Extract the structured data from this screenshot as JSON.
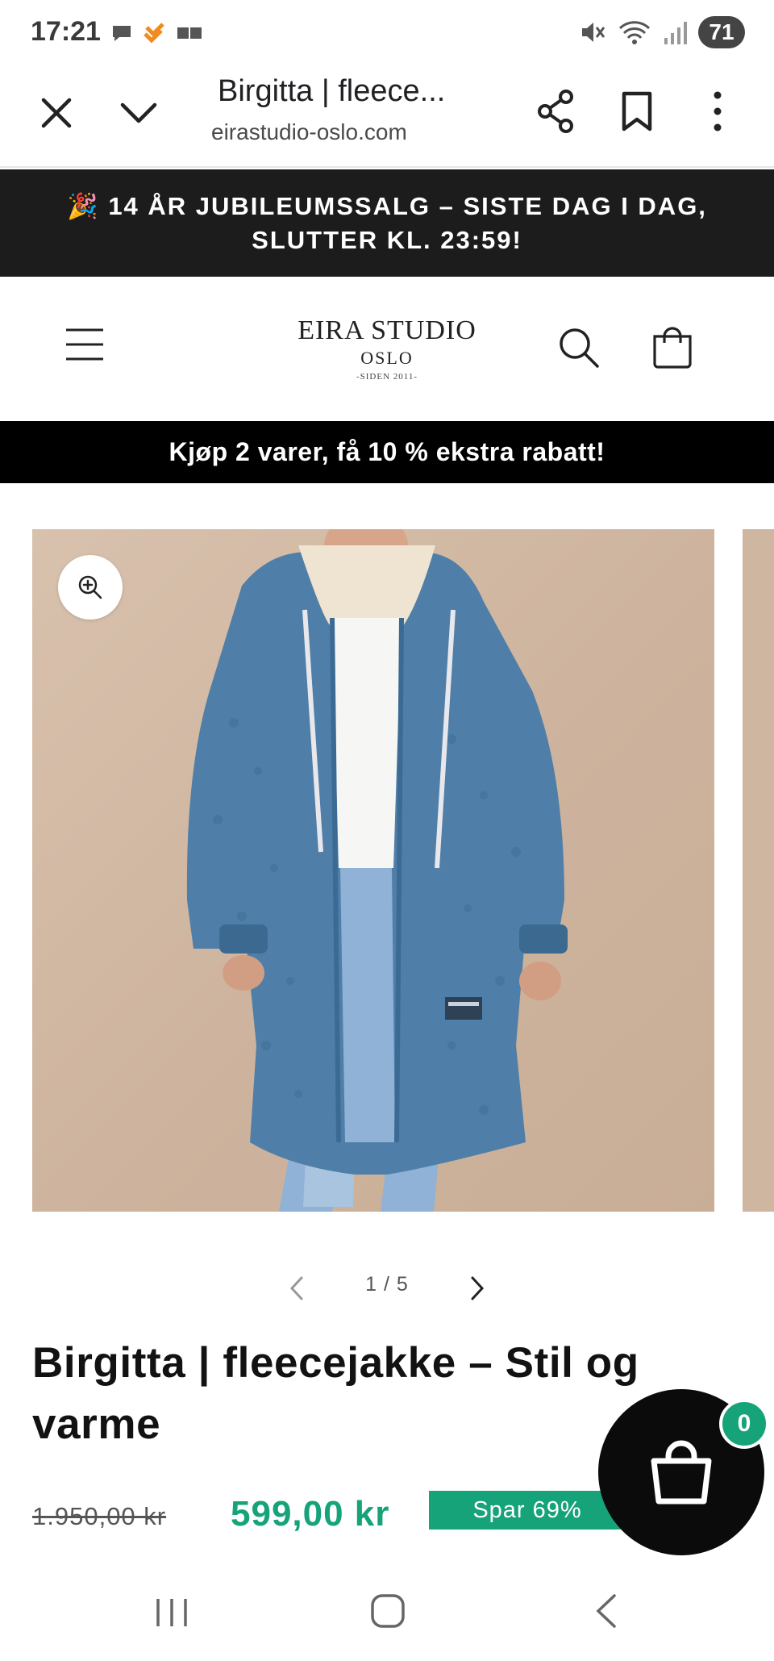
{
  "status_bar": {
    "time": "17:21",
    "battery": "71",
    "icons_left": [
      "chat-bubble-icon",
      "heart-app-icon",
      "media-icon"
    ],
    "icons_right": [
      "mute-icon",
      "wifi-icon",
      "signal-icon"
    ]
  },
  "browser": {
    "page_title": "Birgitta | fleece...",
    "url": "eirastudio-oslo.com"
  },
  "announcement": {
    "emoji": "🎉",
    "text": "14 ÅR JUBILEUMSSALG – SISTE DAG I DAG, SLUTTER KL. 23:59!"
  },
  "header": {
    "logo_line1": "EIRA STUDIO",
    "logo_line2": "OSLO",
    "logo_line3": "-SIDEN 2011-"
  },
  "promo": {
    "text": "Kjøp 2 varer, få 10 % ekstra rabatt!"
  },
  "gallery": {
    "counter": "1 / 5",
    "current": 1,
    "total": 5
  },
  "product": {
    "title": "Birgitta | fleecejakke – Stil og varme",
    "old_price": "1.950,00 kr",
    "new_price": "599,00 kr",
    "save_label": "Spar 69%"
  },
  "floating_cart": {
    "count": "0"
  },
  "colors": {
    "accent_green": "#16a37a",
    "announcement_bg": "#1c1c1c",
    "promo_bg": "#000000",
    "jacket_blue": "#4f7fa8"
  }
}
